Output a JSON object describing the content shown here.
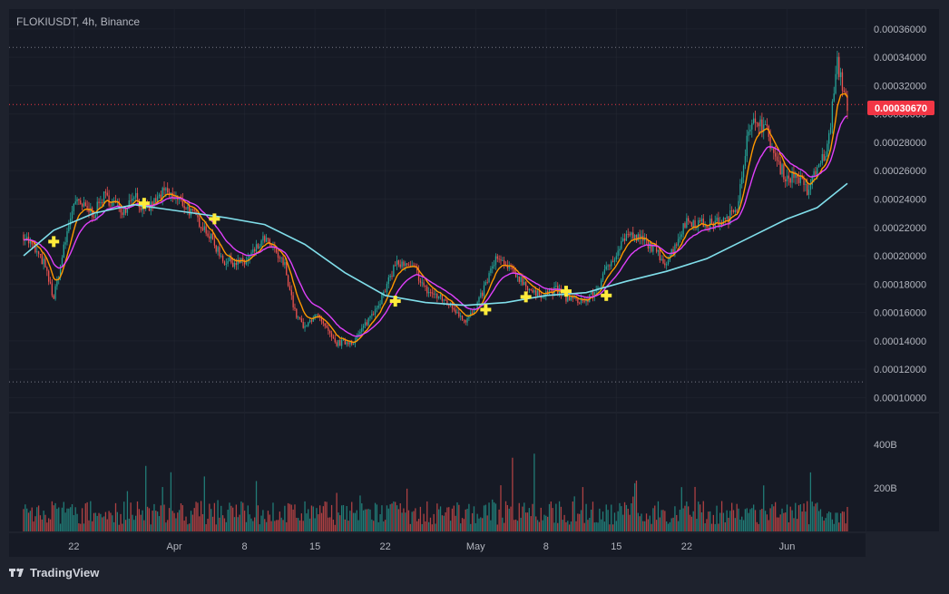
{
  "symbol_title": "FLOKIUSDT, 4h, Binance",
  "brand": "TradingView",
  "colors": {
    "background": "#1e222d",
    "pane": "#161a25",
    "grid": "#2a2e39",
    "text": "#b2b5be",
    "up": "#26a69a",
    "down": "#ef5350",
    "ma_fast": "#ff9800",
    "ma_mid": "#e040fb",
    "ma_slow": "#80deea",
    "marker": "#ffeb3b",
    "last_price_bg": "#f23645"
  },
  "last_price_label": "0.00030670",
  "chart_data": [
    {
      "type": "line",
      "title": "FLOKIUSDT, 4h, Binance",
      "ylim": [
        9e-05,
        0.000374
      ],
      "yticks": [
        "0.00036000",
        "0.00034000",
        "0.00032000",
        "0.00030000",
        "0.00028000",
        "0.00026000",
        "0.00024000",
        "0.00022000",
        "0.00020000",
        "0.00018000",
        "0.00016000",
        "0.00014000",
        "0.00012000",
        "0.00010000"
      ],
      "xticks": [
        "22",
        "Apr",
        "8",
        "15",
        "22",
        "May",
        "8",
        "15",
        "22",
        "Jun"
      ],
      "last_price": 0.0003067,
      "horizontal_levels": [
        0.000347,
        0.000111
      ],
      "price_path": [
        {
          "x": "Mar 17",
          "y": 0.000215
        },
        {
          "x": "Mar 19",
          "y": 0.000195
        },
        {
          "x": "Mar 20",
          "y": 0.00017
        },
        {
          "x": "Mar 21",
          "y": 0.000205
        },
        {
          "x": "Mar 22",
          "y": 0.000238
        },
        {
          "x": "Mar 24",
          "y": 0.00023
        },
        {
          "x": "Mar 25",
          "y": 0.000242
        },
        {
          "x": "Mar 27",
          "y": 0.000232
        },
        {
          "x": "Mar 28",
          "y": 0.000245
        },
        {
          "x": "Mar 29",
          "y": 0.00023
        },
        {
          "x": "Mar 31",
          "y": 0.000245
        },
        {
          "x": "Apr 2",
          "y": 0.000236
        },
        {
          "x": "Apr 4",
          "y": 0.00022
        },
        {
          "x": "Apr 6",
          "y": 0.000196
        },
        {
          "x": "Apr 8",
          "y": 0.000195
        },
        {
          "x": "Apr 10",
          "y": 0.000212
        },
        {
          "x": "Apr 12",
          "y": 0.000193
        },
        {
          "x": "Apr 13",
          "y": 0.00016
        },
        {
          "x": "Apr 14",
          "y": 0.000148
        },
        {
          "x": "Apr 15",
          "y": 0.00016
        },
        {
          "x": "Apr 17",
          "y": 0.000138
        },
        {
          "x": "Apr 19",
          "y": 0.00014
        },
        {
          "x": "Apr 21",
          "y": 0.000163
        },
        {
          "x": "Apr 22",
          "y": 0.000175
        },
        {
          "x": "Apr 23",
          "y": 0.000195
        },
        {
          "x": "Apr 25",
          "y": 0.00019
        },
        {
          "x": "Apr 26",
          "y": 0.000176
        },
        {
          "x": "Apr 28",
          "y": 0.000168
        },
        {
          "x": "Apr 30",
          "y": 0.000155
        },
        {
          "x": "May 1",
          "y": 0.000162
        },
        {
          "x": "May 3",
          "y": 0.000198
        },
        {
          "x": "May 5",
          "y": 0.000187
        },
        {
          "x": "May 7",
          "y": 0.000172
        },
        {
          "x": "May 9",
          "y": 0.000176
        },
        {
          "x": "May 10",
          "y": 0.00017
        },
        {
          "x": "May 12",
          "y": 0.000168
        },
        {
          "x": "May 13",
          "y": 0.000176
        },
        {
          "x": "May 14",
          "y": 0.00019
        },
        {
          "x": "May 16",
          "y": 0.000215
        },
        {
          "x": "May 18",
          "y": 0.00021
        },
        {
          "x": "May 20",
          "y": 0.000195
        },
        {
          "x": "May 22",
          "y": 0.000225
        },
        {
          "x": "May 24",
          "y": 0.000222
        },
        {
          "x": "May 26",
          "y": 0.000225
        },
        {
          "x": "May 27",
          "y": 0.000235
        },
        {
          "x": "May 28",
          "y": 0.000282
        },
        {
          "x": "May 29",
          "y": 0.000298
        },
        {
          "x": "May 30",
          "y": 0.000287
        },
        {
          "x": "May 31",
          "y": 0.000265
        },
        {
          "x": "Jun 1",
          "y": 0.000255
        },
        {
          "x": "Jun 2",
          "y": 0.000257
        },
        {
          "x": "Jun 3",
          "y": 0.000245
        },
        {
          "x": "Jun 4",
          "y": 0.000262
        },
        {
          "x": "Jun 5",
          "y": 0.000275
        },
        {
          "x": "Jun 6",
          "y": 0.000335
        },
        {
          "x": "Jun 7",
          "y": 0.0003067
        }
      ],
      "series": [
        {
          "name": "",
          "color": "#ff9800",
          "style": "fast moving average"
        },
        {
          "name": "",
          "color": "#e040fb",
          "style": "medium moving average"
        },
        {
          "name": "",
          "color": "#80deea",
          "style": "slow moving average",
          "values": [
            {
              "x": "Mar 17",
              "y": 0.0002
            },
            {
              "x": "Mar 20",
              "y": 0.000218
            },
            {
              "x": "Mar 24",
              "y": 0.00023
            },
            {
              "x": "Mar 28",
              "y": 0.000236
            },
            {
              "x": "Apr 1",
              "y": 0.000232
            },
            {
              "x": "Apr 6",
              "y": 0.000227
            },
            {
              "x": "Apr 10",
              "y": 0.000222
            },
            {
              "x": "Apr 14",
              "y": 0.000208
            },
            {
              "x": "Apr 18",
              "y": 0.000188
            },
            {
              "x": "Apr 22",
              "y": 0.000172
            },
            {
              "x": "Apr 26",
              "y": 0.000167
            },
            {
              "x": "Apr 30",
              "y": 0.000165
            },
            {
              "x": "May 4",
              "y": 0.000167
            },
            {
              "x": "May 8",
              "y": 0.000172
            },
            {
              "x": "May 12",
              "y": 0.000174
            },
            {
              "x": "May 16",
              "y": 0.000182
            },
            {
              "x": "May 20",
              "y": 0.000189
            },
            {
              "x": "May 24",
              "y": 0.000198
            },
            {
              "x": "May 28",
              "y": 0.000212
            },
            {
              "x": "Jun 1",
              "y": 0.000226
            },
            {
              "x": "Jun 4",
              "y": 0.000234
            },
            {
              "x": "Jun 7",
              "y": 0.000251
            }
          ]
        }
      ],
      "cross_markers": [
        {
          "x": "Mar 20",
          "y": 0.00021
        },
        {
          "x": "Mar 29",
          "y": 0.000237
        },
        {
          "x": "Apr 5",
          "y": 0.000226
        },
        {
          "x": "Apr 23",
          "y": 0.000168
        },
        {
          "x": "May 2",
          "y": 0.000162
        },
        {
          "x": "May 6",
          "y": 0.000171
        },
        {
          "x": "May 10",
          "y": 0.000175
        },
        {
          "x": "May 14",
          "y": 0.000172
        }
      ]
    },
    {
      "type": "bar",
      "title": "",
      "ylim": [
        0,
        500000000000
      ],
      "yticks": [
        "400B",
        "200B"
      ],
      "note": "volume histogram colored by candle direction"
    }
  ]
}
